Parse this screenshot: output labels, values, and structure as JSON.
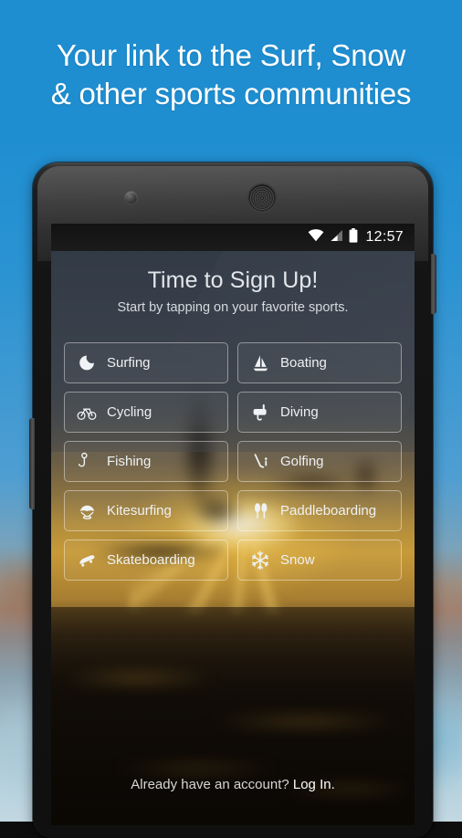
{
  "page": {
    "headline_line1": "Your link to the Surf, Snow",
    "headline_line2": "& other sports communities",
    "background_top_color": "#1e8ed1",
    "background_bottom_color": "#c2d8e2"
  },
  "device": {
    "front_camera_icon": "camera-icon",
    "earpiece_icon": "speaker-grille-icon",
    "power_button": "power-button",
    "volume_button": "volume-button"
  },
  "statusbar": {
    "wifi_icon": "wifi-icon",
    "signal_icon": "cell-signal-icon",
    "battery_icon": "battery-icon",
    "clock": "12:57"
  },
  "app": {
    "title": "Time to Sign Up!",
    "subtitle": "Start by tapping on your favorite sports.",
    "sports": [
      {
        "label": "Surfing",
        "icon": "wave-icon"
      },
      {
        "label": "Boating",
        "icon": "sailboat-icon"
      },
      {
        "label": "Cycling",
        "icon": "bicycle-icon"
      },
      {
        "label": "Diving",
        "icon": "snorkel-mask-icon"
      },
      {
        "label": "Fishing",
        "icon": "fish-hook-icon"
      },
      {
        "label": "Golfing",
        "icon": "golf-club-icon"
      },
      {
        "label": "Kitesurfing",
        "icon": "kite-icon"
      },
      {
        "label": "Paddleboarding",
        "icon": "paddles-icon"
      },
      {
        "label": "Skateboarding",
        "icon": "skateboard-icon"
      },
      {
        "label": "Snow",
        "icon": "snowflake-icon"
      }
    ],
    "login_prompt": "Already have an account?",
    "login_link": "Log In."
  }
}
